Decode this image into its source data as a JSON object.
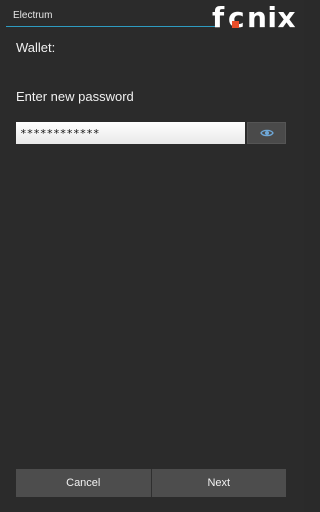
{
  "window": {
    "title": "Electrum",
    "brand": "fcnix"
  },
  "content": {
    "wallet_label": "Wallet:",
    "prompt": "Enter new password",
    "password_value": "************"
  },
  "icons": {
    "visibility_toggle": "eye-icon"
  },
  "footer": {
    "cancel_label": "Cancel",
    "next_label": "Next"
  },
  "colors": {
    "background": "#2b2b2b",
    "accent_rule": "#2e9bc0",
    "logo_mark": "#e94e2a",
    "button_bg": "#4d4d4d"
  }
}
